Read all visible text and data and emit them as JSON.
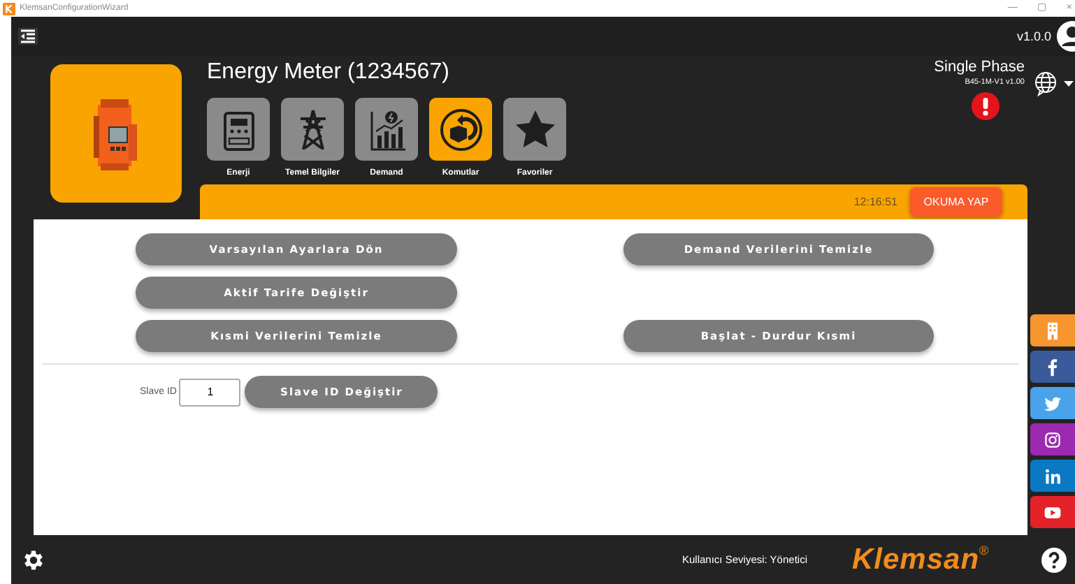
{
  "window": {
    "title": "KlemsanConfigurationWizard",
    "controls": [
      "—",
      "▢",
      "×"
    ]
  },
  "top_bar": {
    "version": "v1.0.0"
  },
  "device": {
    "title": "Energy Meter (1234567)",
    "phase": "Single Phase",
    "model": "B45-1M-V1 v1.00",
    "alert": true
  },
  "tabs": [
    {
      "label": "Enerji",
      "kind": "meter",
      "selected": false
    },
    {
      "label": "Temel Bilgiler",
      "kind": "tower",
      "selected": false
    },
    {
      "label": "Demand",
      "kind": "chart",
      "selected": false
    },
    {
      "label": "Komutlar",
      "kind": "commands",
      "selected": true
    },
    {
      "label": "Favoriler",
      "kind": "star",
      "selected": false
    }
  ],
  "read_bar": {
    "time": "12:16:51",
    "button": "OKUMA YAP"
  },
  "command_rows": [
    {
      "left": "Varsayılan Ayarlara Dön",
      "right": "Demand Verilerini Temizle"
    },
    {
      "left": "Aktif Tarife Değiştir"
    },
    {
      "left": "Kısmi Verilerini Temizle",
      "right": "Başlat - Durdur Kısmi"
    }
  ],
  "slave": {
    "label": "Slave ID",
    "value": "1",
    "button": "Slave ID Değiştir"
  },
  "social": [
    {
      "kind": "building",
      "color": "#f7952f"
    },
    {
      "kind": "facebook",
      "color": "#3b5a9a"
    },
    {
      "kind": "twitter",
      "color": "#4aa3ea"
    },
    {
      "kind": "instagram",
      "color": "#9c2ab0"
    },
    {
      "kind": "linkedin",
      "color": "#0a78c2"
    },
    {
      "kind": "youtube",
      "color": "#e3222a"
    }
  ],
  "footer": {
    "user_level": "Kullanıcı Seviyesi: Yönetici",
    "brand": "Klemsan$^{®}$"
  }
}
